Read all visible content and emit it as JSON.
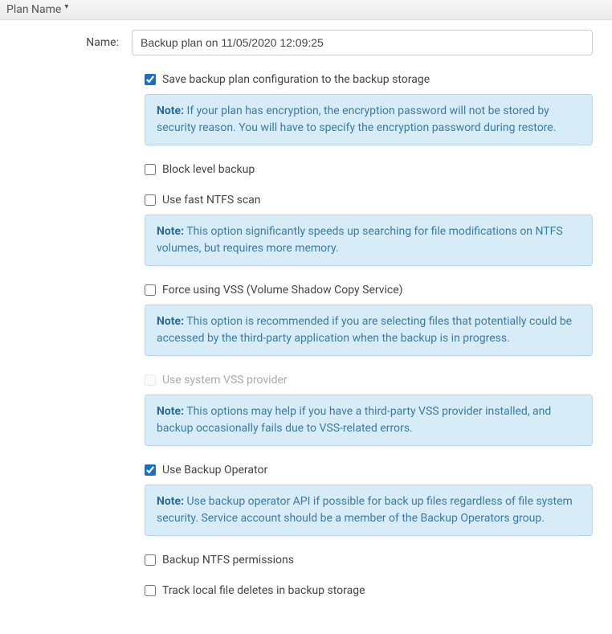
{
  "header": {
    "title": "Plan Name"
  },
  "form": {
    "name_label": "Name:",
    "name_value": "Backup plan on 11/05/2020 12:09:25"
  },
  "options": [
    {
      "key": "save_config",
      "label": "Save backup plan configuration to the backup storage",
      "checked": true,
      "disabled": false,
      "note": "If your plan has encryption, the encryption password will not be stored by security reason. You will have to specify the encryption password during restore."
    },
    {
      "key": "block_level",
      "label": "Block level backup",
      "checked": false,
      "disabled": false,
      "note": null
    },
    {
      "key": "fast_ntfs",
      "label": "Use fast NTFS scan",
      "checked": false,
      "disabled": false,
      "note": "This option significantly speeds up searching for file modifications on NTFS volumes, but requires more memory."
    },
    {
      "key": "force_vss",
      "label": "Force using VSS (Volume Shadow Copy Service)",
      "checked": false,
      "disabled": false,
      "note": "This option is recommended if you are selecting files that potentially could be accessed by the third-party application when the backup is in progress."
    },
    {
      "key": "system_vss",
      "label": "Use system VSS provider",
      "checked": false,
      "disabled": true,
      "note": "This options may help if you have a third-party VSS provider installed, and backup occasionally fails due to VSS-related errors."
    },
    {
      "key": "backup_operator",
      "label": "Use Backup Operator",
      "checked": true,
      "disabled": false,
      "note": "Use backup operator API if possible for back up files regardless of file system security. Service account should be a member of the Backup Operators group."
    },
    {
      "key": "ntfs_perms",
      "label": "Backup NTFS permissions",
      "checked": false,
      "disabled": false,
      "note": null
    },
    {
      "key": "track_deletes",
      "label": "Track local file deletes in backup storage",
      "checked": false,
      "disabled": false,
      "note": null
    }
  ],
  "note_label": "Note:"
}
